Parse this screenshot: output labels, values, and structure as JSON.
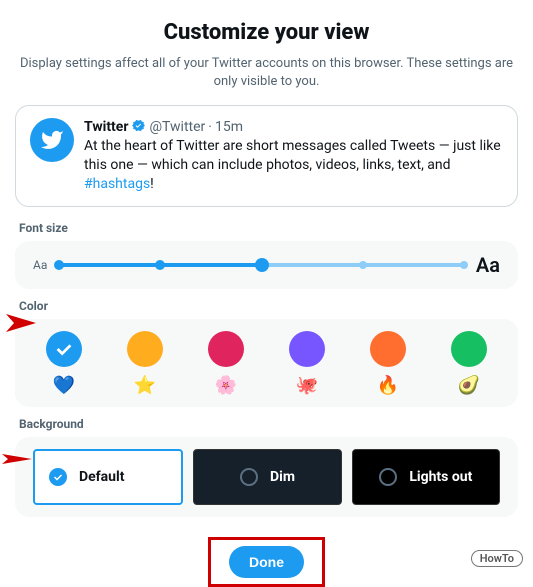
{
  "title": "Customize your view",
  "subtitle": "Display settings affect all of your Twitter accounts on this browser. These settings are only visible to you.",
  "tweet": {
    "name": "Twitter",
    "handle": "@Twitter",
    "sep": "·",
    "time": "15m",
    "text_before": "At the heart of Twitter are short messages called Tweets — just like this one — which can include photos, videos, links, text, and ",
    "hashtag": "#hashtags",
    "text_after": "!"
  },
  "sections": {
    "font_size": "Font size",
    "color": "Color",
    "background": "Background"
  },
  "font_size": {
    "small_marker": "Aa",
    "large_marker": "Aa",
    "selected_index": 2
  },
  "colors": [
    {
      "hex": "#1d9bf0",
      "emoji": "💙",
      "selected": true
    },
    {
      "hex": "#ffad1f",
      "emoji": "⭐",
      "selected": false
    },
    {
      "hex": "#e0245e",
      "emoji": "🌸",
      "selected": false
    },
    {
      "hex": "#7856ff",
      "emoji": "🐙",
      "selected": false
    },
    {
      "hex": "#ff6e2e",
      "emoji": "🔥",
      "selected": false
    },
    {
      "hex": "#17bf63",
      "emoji": "🥑",
      "selected": false
    }
  ],
  "backgrounds": {
    "default": "Default",
    "dim": "Dim",
    "lights_out": "Lights out",
    "selected": "default"
  },
  "done_label": "Done",
  "howto_label": "HowTo"
}
